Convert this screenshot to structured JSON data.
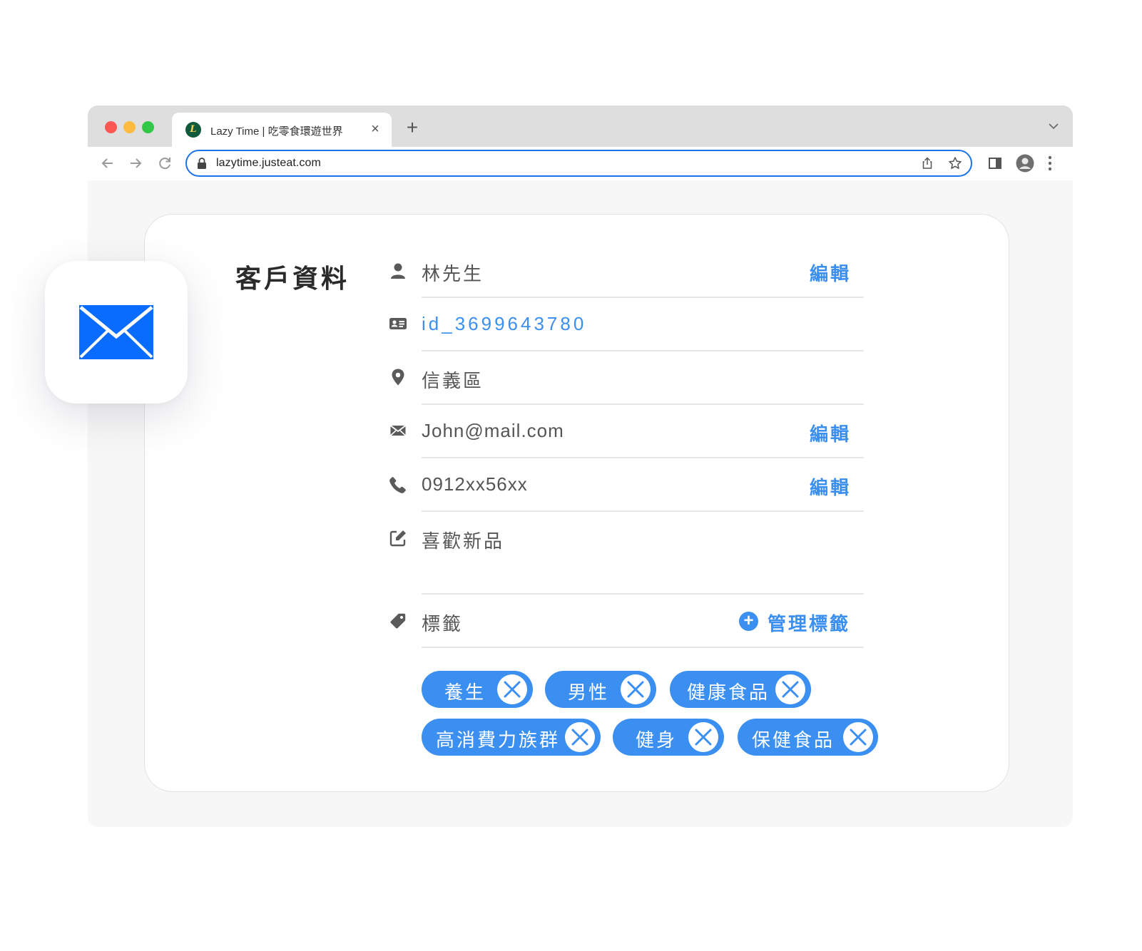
{
  "browser": {
    "tab_title": "Lazy Time | 吃零食環遊世界",
    "favicon_letter": "L",
    "url": "lazytime.justeat.com",
    "icons": [
      "back-arrow-icon",
      "forward-arrow-icon",
      "reload-icon",
      "lock-icon",
      "share-icon",
      "star-icon",
      "sidebar-icon",
      "profile-icon",
      "more-icon",
      "close-icon",
      "plus-icon",
      "chevron-down-icon"
    ]
  },
  "card": {
    "title": "客戶資料",
    "rows": {
      "name": {
        "icon": "user-icon",
        "value": "林先生",
        "action": "編輯"
      },
      "id": {
        "icon": "id-card-icon",
        "value": "id_3699643780"
      },
      "district": {
        "icon": "location-pin-icon",
        "value": "信義區"
      },
      "email": {
        "icon": "envelope-icon",
        "value": "John@mail.com",
        "action": "編輯"
      },
      "phone": {
        "icon": "phone-icon",
        "value": "0912xx56xx",
        "action": "編輯"
      },
      "note": {
        "icon": "edit-note-icon",
        "value": "喜歡新品"
      }
    },
    "tags_section": {
      "icon": "tag-icon",
      "label": "標籤",
      "manage_label": "管理標籤",
      "manage_icon": "plus-circle-icon"
    },
    "tags": [
      "養生",
      "男性",
      "健康食品",
      "高消費力族群",
      "健身",
      "保健食品"
    ]
  },
  "app_icon": {
    "name": "mail-app-icon"
  },
  "colors": {
    "accent": "#3a8ff0",
    "mail_blue": "#0a6cff",
    "url_focus": "#1a73e8",
    "traffic_red": "#fc5753",
    "traffic_yellow": "#fdbc40",
    "traffic_green": "#33c748"
  }
}
